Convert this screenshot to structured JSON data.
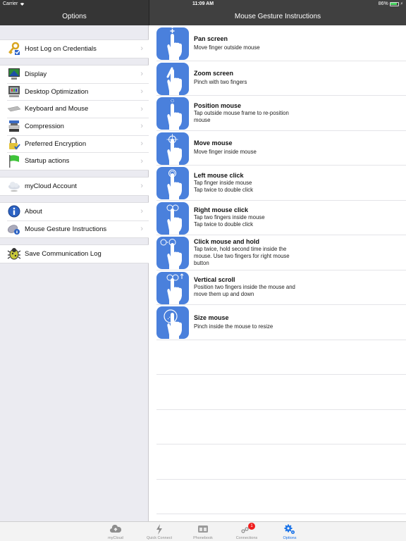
{
  "status_bar": {
    "carrier": "Carrier",
    "time": "11:09 AM",
    "battery_percent_label": "86%",
    "battery_level": 0.86
  },
  "left_nav": {
    "title": "Options"
  },
  "right_nav": {
    "title": "Mouse Gesture Instructions"
  },
  "options": {
    "sections": [
      {
        "items": [
          {
            "label": "Host Log on Credentials",
            "icon": "key-icon",
            "chevron": true
          }
        ]
      },
      {
        "items": [
          {
            "label": "Display",
            "icon": "display-icon",
            "chevron": true
          },
          {
            "label": "Desktop Optimization",
            "icon": "monitor-icon",
            "chevron": true
          },
          {
            "label": "Keyboard and Mouse",
            "icon": "keyboard-icon",
            "chevron": true
          },
          {
            "label": "Compression",
            "icon": "compression-icon",
            "chevron": true
          },
          {
            "label": "Preferred Encryption",
            "icon": "lock-icon",
            "chevron": true
          },
          {
            "label": "Startup actions",
            "icon": "flag-icon",
            "chevron": true
          }
        ]
      },
      {
        "items": [
          {
            "label": "myCloud Account",
            "icon": "cloud-icon",
            "chevron": true
          }
        ]
      },
      {
        "items": [
          {
            "label": "About",
            "icon": "info-icon",
            "chevron": true
          },
          {
            "label": "Mouse Gesture Instructions",
            "icon": "mouse-info-icon",
            "chevron": true
          }
        ]
      },
      {
        "items": [
          {
            "label": "Save Communication Log",
            "icon": "bug-icon",
            "chevron": false
          }
        ]
      }
    ],
    "chevron_glyph": "›"
  },
  "gestures": [
    {
      "title": "Pan screen",
      "description": "Move finger outside mouse",
      "icon": "pan-gesture-icon"
    },
    {
      "title": "Zoom screen",
      "description": "Pinch with two fingers",
      "icon": "pinch-gesture-icon"
    },
    {
      "title": "Position mouse",
      "description": "Tap outside mouse frame to re-position\nmouse",
      "icon": "position-gesture-icon"
    },
    {
      "title": "Move mouse",
      "description": "Move finger inside mouse",
      "icon": "move-gesture-icon"
    },
    {
      "title": "Left mouse click",
      "description": "Tap finger inside mouse\nTap twice to double click",
      "icon": "tap-gesture-icon"
    },
    {
      "title": "Right mouse click",
      "description": "Tap two fingers inside mouse\nTap twice to double click",
      "icon": "two-finger-tap-gesture-icon"
    },
    {
      "title": "Click mouse and hold",
      "description": "Tap twice, hold second time inside the\nmouse. Use two fingers for right mouse\nbutton",
      "icon": "tap-hold-gesture-icon"
    },
    {
      "title": "Vertical scroll",
      "description": "Position two fingers inside the mouse and\nmove them up and down",
      "icon": "scroll-gesture-icon"
    },
    {
      "title": "Size mouse",
      "description": "Pinch inside the mouse to resize",
      "icon": "resize-gesture-icon"
    }
  ],
  "empty_rows": 5,
  "tabbar": {
    "tabs": [
      {
        "label": "myCloud",
        "icon": "cloud-upload-icon",
        "active": false
      },
      {
        "label": "Quick Connect",
        "icon": "lightning-icon",
        "active": false
      },
      {
        "label": "Phonebook",
        "icon": "phonebook-icon",
        "active": false
      },
      {
        "label": "Connections",
        "icon": "connections-icon",
        "active": false,
        "badge": "1"
      },
      {
        "label": "Options",
        "icon": "gears-icon",
        "active": true
      }
    ]
  },
  "colors": {
    "accent": "#1a73e8",
    "gesture_icon_bg": "#4a80dc",
    "nav_bg": "#404040",
    "badge": "#f01d1d",
    "battery": "#4cd964"
  }
}
